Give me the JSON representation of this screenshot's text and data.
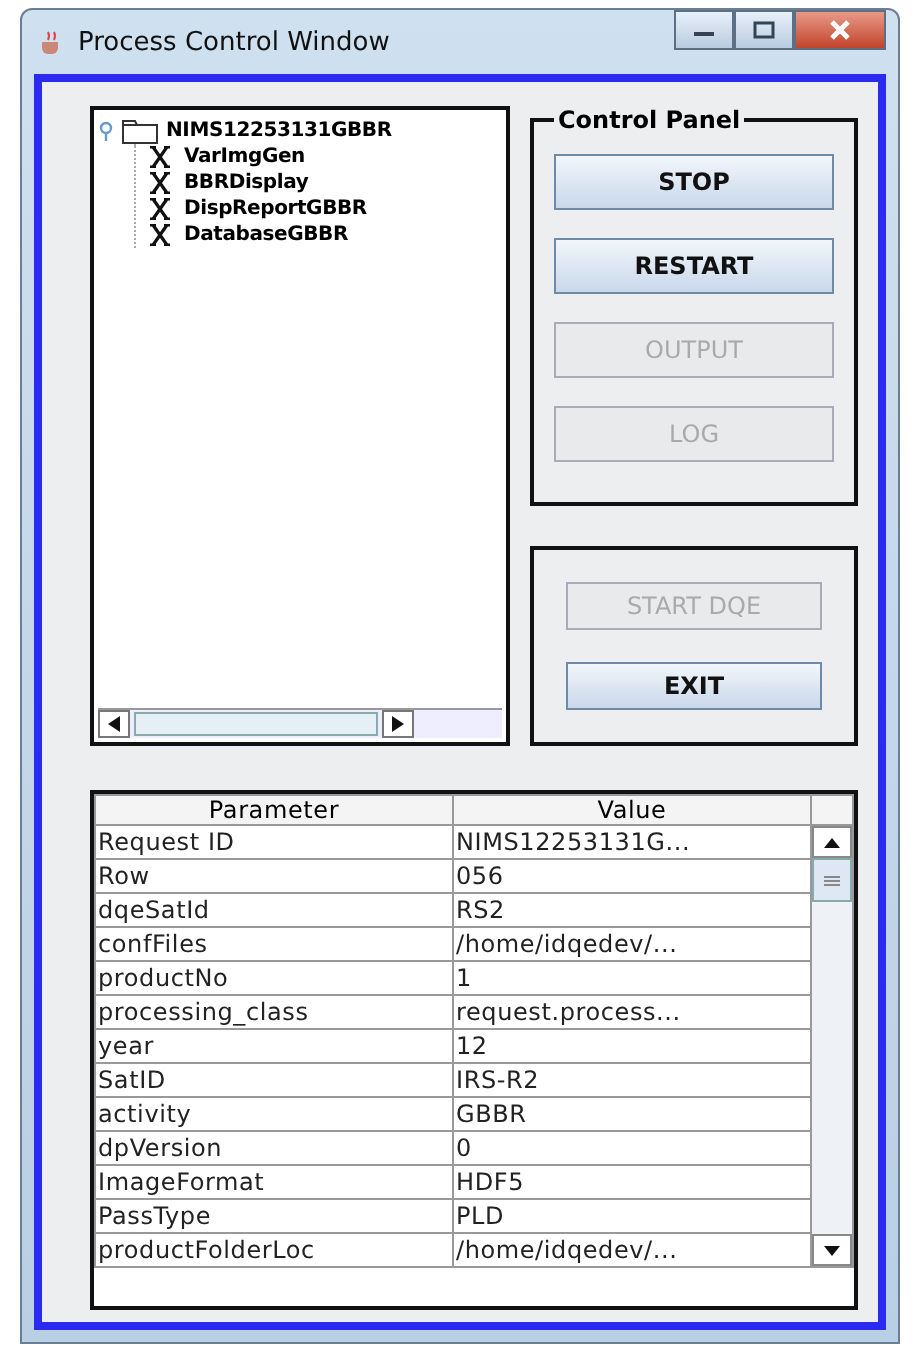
{
  "window": {
    "title": "Process Control Window"
  },
  "tree": {
    "label": "NIMS12253131GBBR",
    "expanded": true,
    "children": [
      {
        "label": "VarImgGen"
      },
      {
        "label": "BBRDisplay"
      },
      {
        "label": "DispReportGBBR"
      },
      {
        "label": "DatabaseGBBR"
      }
    ]
  },
  "control_panel": {
    "title": "Control Panel",
    "buttons": [
      {
        "label": "STOP",
        "disabled": false
      },
      {
        "label": "RESTART",
        "disabled": false
      },
      {
        "label": "OUTPUT",
        "disabled": true
      },
      {
        "label": "LOG",
        "disabled": true
      }
    ]
  },
  "action_buttons": [
    {
      "label": "START DQE",
      "disabled": true
    },
    {
      "label": "EXIT",
      "disabled": false
    }
  ],
  "table": {
    "columns": [
      "Parameter",
      "Value"
    ],
    "rows": [
      [
        "Request ID",
        "NIMS12253131G..."
      ],
      [
        "Row",
        "056"
      ],
      [
        "dqeSatId",
        "RS2"
      ],
      [
        "confFiles",
        "/home/idqedev/..."
      ],
      [
        "productNo",
        "1"
      ],
      [
        "processing_class",
        "request.process..."
      ],
      [
        "year",
        "12"
      ],
      [
        "SatID",
        "IRS-R2"
      ],
      [
        "activity",
        "GBBR"
      ],
      [
        "dpVersion",
        "0"
      ],
      [
        "ImageFormat",
        "HDF5"
      ],
      [
        "PassType",
        "PLD"
      ],
      [
        "productFolderLoc",
        "/home/idqedev/..."
      ]
    ]
  }
}
